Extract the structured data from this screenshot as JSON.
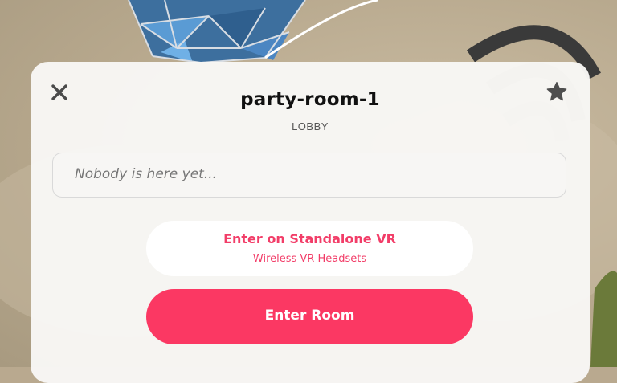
{
  "room": {
    "name": "party-room-1",
    "subtitle": "LOBBY"
  },
  "presence": {
    "text": "Nobody is here yet..."
  },
  "buttons": {
    "standalone_vr_label": "Enter on Standalone VR",
    "standalone_vr_sublabel": "Wireless VR Headsets",
    "enter_room_label": "Enter Room"
  },
  "icons": {
    "close": "close-icon",
    "favorite": "star-icon"
  },
  "colors": {
    "accent": "#fb3863",
    "accent_text": "#f23d68",
    "panel": "#f8f7f5"
  }
}
